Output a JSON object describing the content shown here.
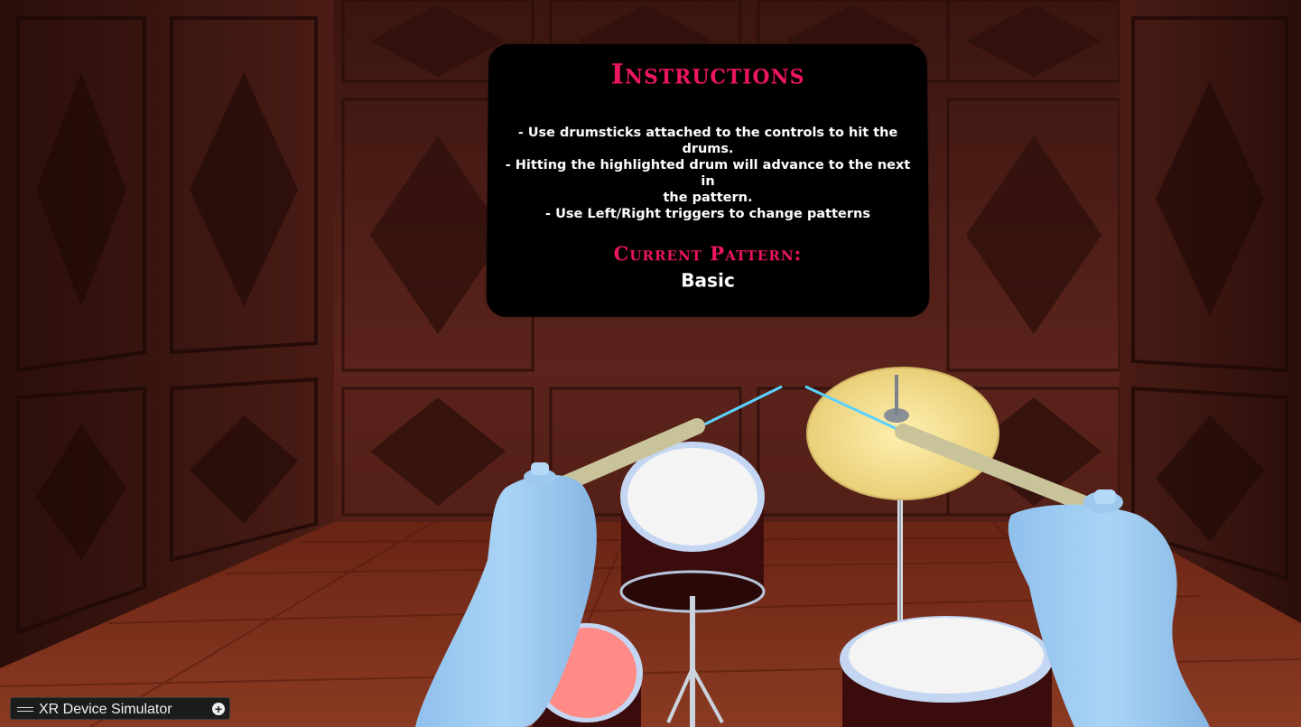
{
  "instructions_panel": {
    "title": "Instructions",
    "lines": [
      "- Use drumsticks attached to the controls to hit the",
      "drums.",
      "- Hitting the highlighted drum will advance to the next in",
      "the pattern.",
      "- Use Left/Right triggers to change patterns"
    ],
    "current_pattern_label": "Current Pattern:",
    "current_pattern_value": "Basic"
  },
  "xr_device_simulator": {
    "label": "XR Device Simulator",
    "handle_icon": "drag-handle-icon",
    "expand_icon": "plus-circle-icon"
  },
  "colors": {
    "accent": "#ee1660",
    "panel_bg": "#000000",
    "wall": "#4a1c16",
    "floor": "#7a2a1a",
    "controller": "#9ccaf0",
    "highlighted_drum": "#ff8a86",
    "cymbal": "#f2dc8c"
  }
}
